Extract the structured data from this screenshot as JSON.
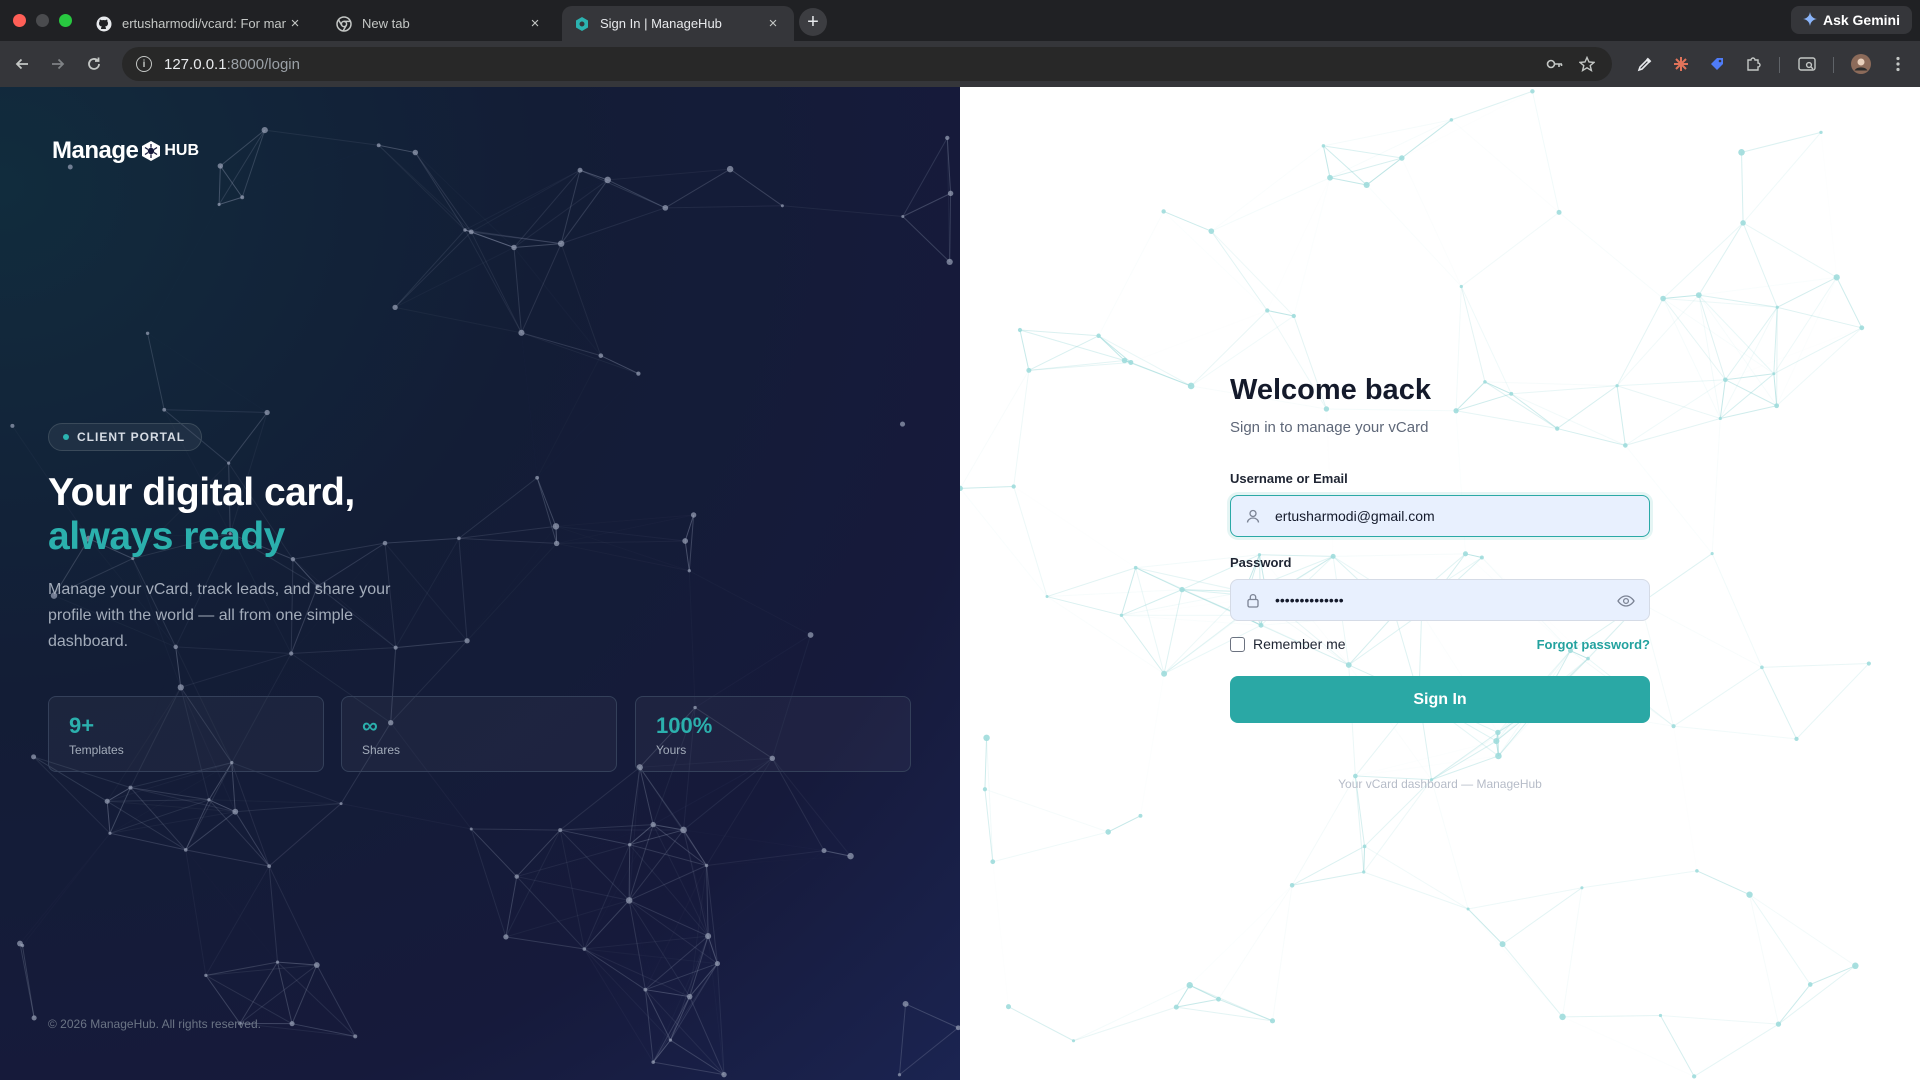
{
  "browser": {
    "tabs": [
      {
        "title": "ertusharmodi/vcard: For man",
        "favicon": "github-icon",
        "active": false
      },
      {
        "title": "New tab",
        "favicon": "chrome-icon",
        "active": false
      },
      {
        "title": "Sign In | ManageHub",
        "favicon": "managehub-icon",
        "active": true
      }
    ],
    "close_glyph": "×",
    "new_tab_glyph": "+",
    "gemini_label": "Ask Gemini",
    "url_host": "127.0.0.1",
    "url_path": ":8000/login",
    "icons": [
      "back-icon",
      "forward-icon",
      "reload-icon",
      "site-info-icon",
      "key-icon",
      "star-icon",
      "eyedropper-icon",
      "claude-extension-icon",
      "tag-extension-icon",
      "extensions-puzzle-icon",
      "side-panel-icon",
      "profile-avatar",
      "more-menu-icon"
    ]
  },
  "brand": {
    "logo_word": "Manage",
    "logo_hub": "HUB",
    "accent": "#2aa8a5",
    "dark_bg": "#161a3b"
  },
  "left": {
    "badge": "CLIENT PORTAL",
    "hero_line1": "Your digital card,",
    "hero_line2": "always ready",
    "subtext": "Manage your vCard, track leads, and share your profile with the world — all from one simple dashboard.",
    "stats": [
      {
        "value": "9+",
        "label": "Templates"
      },
      {
        "value": "∞",
        "label": "Shares"
      },
      {
        "value": "100%",
        "label": "Yours"
      }
    ],
    "copyright": "© 2026 ManageHub. All rights reserved."
  },
  "form": {
    "title": "Welcome back",
    "subtitle": "Sign in to manage your vCard",
    "username_label": "Username or Email",
    "username_value": "ertusharmodi@gmail.com",
    "password_label": "Password",
    "password_value": "••••••••••••••",
    "remember_label": "Remember me",
    "remember_checked": false,
    "forgot_label": "Forgot password?",
    "submit_label": "Sign In",
    "footer_note": "Your vCard dashboard — ManageHub"
  }
}
